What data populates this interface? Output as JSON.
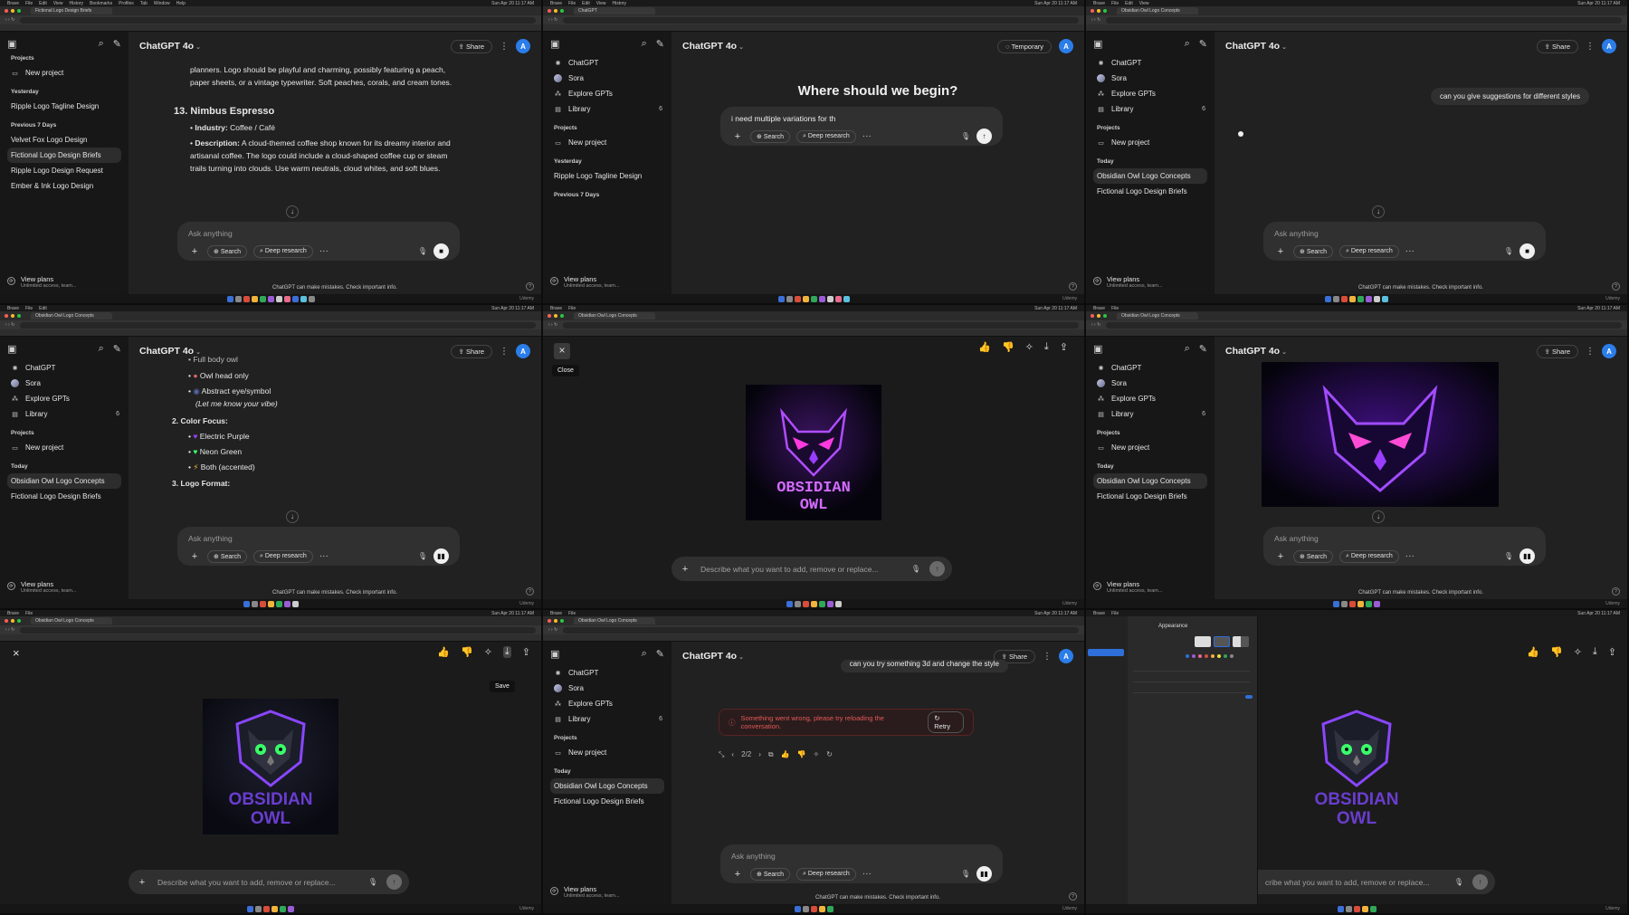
{
  "menubar": {
    "items": [
      "Brave",
      "File",
      "Edit",
      "View",
      "History",
      "Bookmarks",
      "Profiles",
      "Tab",
      "Window",
      "Help"
    ],
    "clock": "Sun Apr 20 11:17 AM"
  },
  "dock": {
    "label": "Udemy"
  },
  "sidebar": {
    "chatgpt": "ChatGPT",
    "sora": "Sora",
    "explore": "Explore GPTs",
    "library": "Library",
    "library_count": "6",
    "projects": "Projects",
    "new_project": "New project",
    "yesterday": "Yesterday",
    "prev7": "Previous 7 Days",
    "today": "Today",
    "view_plans": "View plans",
    "view_plans_sub": "Unlimited access, team...",
    "chats": {
      "ripple_tagline": "Ripple Logo Tagline Design",
      "velvet": "Velvet Fox Logo Design",
      "fictional": "Fictional Logo Design Briefs",
      "ripple_request": "Ripple Logo Design Request",
      "ember": "Ember & Ink Logo Design",
      "obsidian": "Obsidian Owl Logo Concepts"
    }
  },
  "header": {
    "model": "ChatGPT 4o",
    "share": "Share",
    "temporary": "Temporary",
    "avatar": "A"
  },
  "composer": {
    "placeholder": "Ask anything",
    "search": "Search",
    "deep_research": "Deep research",
    "disclaimer": "ChatGPT can make mistakes. Check important info."
  },
  "p1": {
    "intro": "planners. Logo should be playful and charming, possibly featuring a peach, paper sheets, or a vintage typewriter. Soft peaches, corals, and cream tones.",
    "heading": "13. Nimbus Espresso",
    "industry_label": "Industry:",
    "industry": "Coffee / Café",
    "desc_label": "Description:",
    "desc": "A cloud-themed coffee shop known for its dreamy interior and artisanal coffee. The logo could include a cloud-shaped coffee cup or steam trails turning into clouds. Use warm neutrals, cloud whites, and soft blues."
  },
  "p2": {
    "headline": "Where should we begin?",
    "typed": "i need multiple variations for th"
  },
  "p3": {
    "user": "can you give suggestions for different styles"
  },
  "p4": {
    "cut": "Full body owl",
    "owl_head": "Owl head only",
    "abstract": "Abstract eye/symbol",
    "vibe": "(Let me know your vibe)",
    "color_focus": "2. Color Focus:",
    "purple": "Electric Purple",
    "green": "Neon Green",
    "both": "Both (accented)",
    "logo_format": "3. Logo Format:"
  },
  "viewer": {
    "close_tip": "Close",
    "save_tip": "Save",
    "edit_placeholder": "Describe what you want to add, remove or replace...",
    "owl_line1": "OBSIDIAN",
    "owl_line2": "OWL",
    "edit_placeholder_cut": "cribe what you want to add, remove or replace..."
  },
  "p8": {
    "user": "can you try something 3d and change the style",
    "error": "Something went wrong, please try reloading the conversation.",
    "retry": "Retry",
    "pager": "2/2"
  },
  "p9": {
    "settings_title": "Appearance"
  },
  "colors": {
    "accent_purple": "#9b3dff",
    "neon_green": "#39ff6a",
    "avatar_blue": "#2b7de9",
    "error_red": "#e45858"
  }
}
